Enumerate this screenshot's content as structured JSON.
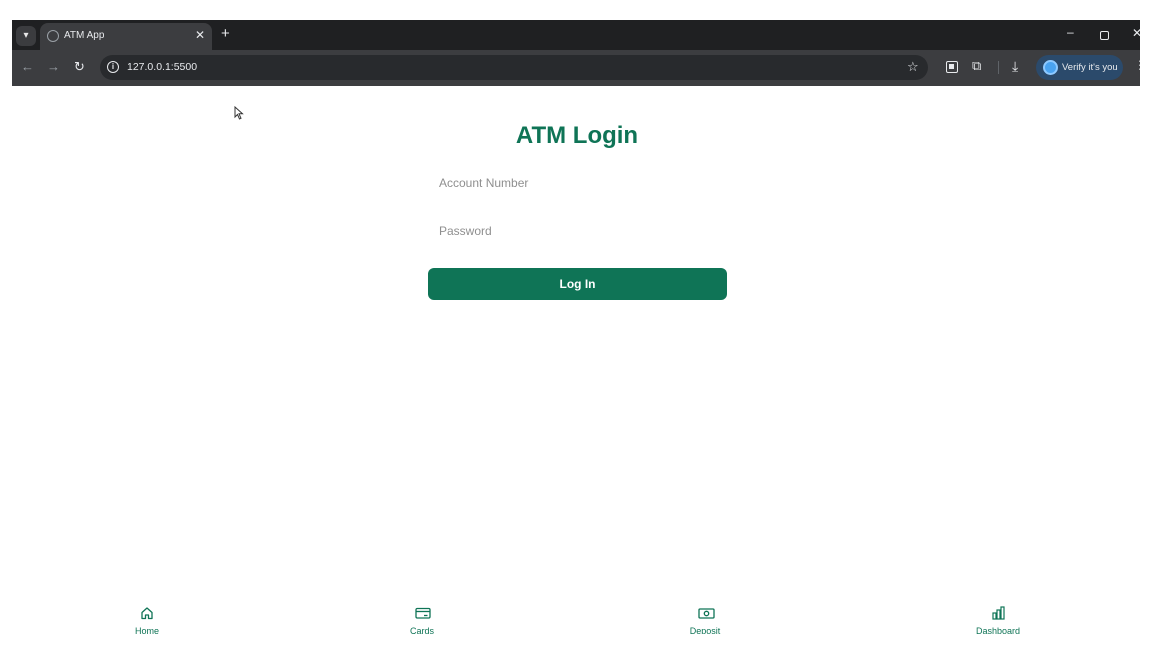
{
  "browser": {
    "tab_title": "ATM App",
    "tab_close": "✕",
    "new_tab": "+",
    "url": "127.0.0.1:5500",
    "profile_label": "Verify it's you",
    "window_min": "–",
    "window_close": "✕"
  },
  "login": {
    "title": "ATM Login",
    "account_placeholder": "Account Number",
    "password_placeholder": "Password",
    "button_label": "Log In"
  },
  "bottom_nav": {
    "items": [
      {
        "label": "Home",
        "icon": "home-icon"
      },
      {
        "label": "Cards",
        "icon": "card-icon"
      },
      {
        "label": "Deposit",
        "icon": "cash-icon"
      },
      {
        "label": "Dashboard",
        "icon": "chart-icon"
      }
    ]
  },
  "colors": {
    "brand_green": "#0f7456",
    "browser_dark": "#1f2022",
    "toolbar": "#3c3d40"
  }
}
